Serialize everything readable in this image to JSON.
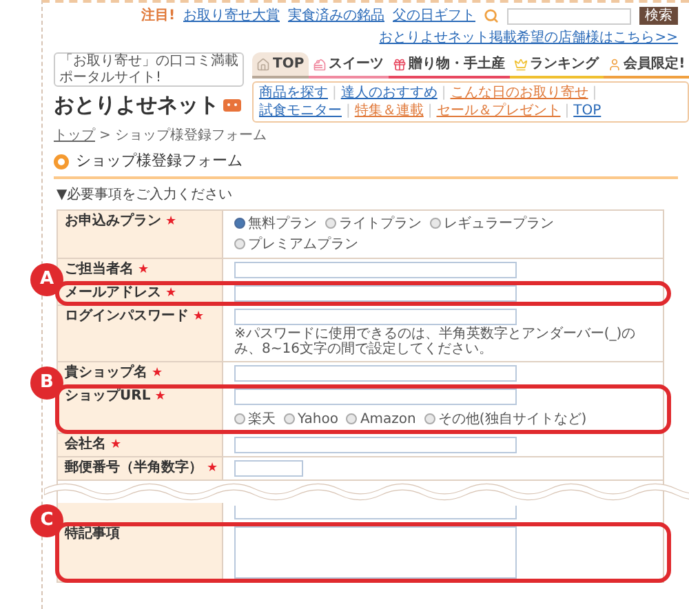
{
  "header": {
    "top_links": {
      "label": "注目!",
      "links": [
        "お取り寄せ大賞",
        "実食済みの銘品",
        "父の日ギフト"
      ]
    },
    "search": {
      "button": "検索"
    },
    "shop_link": "おとりよせネット掲載希望の店舗様はこちら>>",
    "tagline": "「お取り寄せ」の口コミ満載ポータルサイト!",
    "logo": "おとりよせネット",
    "main_nav": [
      {
        "label": "TOP",
        "color": "#b8a898",
        "selected": true
      },
      {
        "label": "スイーツ",
        "color": "#f08aa0",
        "selected": false
      },
      {
        "label": "贈り物・手土産",
        "color": "#e84860",
        "selected": false
      },
      {
        "label": "ランキング",
        "color": "#f0c030",
        "selected": false
      },
      {
        "label": "会員限定!",
        "color": "#f0a040",
        "selected": false
      }
    ],
    "sub_nav": [
      {
        "label": "商品を探す",
        "color": "#2a6ab8"
      },
      {
        "label": "達人のおすすめ",
        "color": "#2a6ab8"
      },
      {
        "label": "こんな日のお取り寄せ",
        "color": "#e07838"
      },
      {
        "label": "試食モニター",
        "color": "#2a6ab8"
      },
      {
        "label": "特集＆連載",
        "color": "#e07838"
      },
      {
        "label": "セール＆プレゼント",
        "color": "#e07838"
      },
      {
        "label": "TOP",
        "color": "#2a6ab8"
      }
    ],
    "separator": "|"
  },
  "breadcrumb": {
    "items": [
      "トップ",
      "ショップ様登録フォーム"
    ],
    "separator": ">"
  },
  "page_title": "ショップ様登録フォーム",
  "instructions": "▼必要事項をご入力ください",
  "required_mark": "★",
  "rows": [
    {
      "kind": "radio",
      "label": "お申込みプラン",
      "required": true,
      "options": [
        {
          "label": "無料プラン",
          "selected": true
        },
        {
          "label": "ライトプラン",
          "selected": false
        },
        {
          "label": "レギュラープラン",
          "selected": false
        },
        {
          "label": "プレミアムプラン",
          "selected": false
        }
      ]
    },
    {
      "kind": "text",
      "label": "ご担当者名",
      "required": true
    },
    {
      "kind": "text",
      "label": "メールアドレス",
      "required": true,
      "annotation": "A"
    },
    {
      "kind": "text",
      "label": "ログインパスワード",
      "required": true,
      "note": "※パスワードに使用できるのは、半角英数字とアンダーバー(_)のみ、8~16文字の間で設定してください。"
    },
    {
      "kind": "text",
      "label": "貴ショップ名",
      "required": true
    },
    {
      "kind": "url",
      "label": "ショップURL",
      "required": true,
      "annotation": "B",
      "options": [
        {
          "label": "楽天",
          "selected": false
        },
        {
          "label": "Yahoo",
          "selected": false
        },
        {
          "label": "Amazon",
          "selected": false
        },
        {
          "label": "その他(独自サイトなど)",
          "selected": false
        }
      ]
    },
    {
      "kind": "text",
      "label": "会社名",
      "required": true
    },
    {
      "kind": "short",
      "label": "郵便番号（半角数字）",
      "required": true
    },
    {
      "kind": "break"
    },
    {
      "kind": "textarea_end"
    },
    {
      "kind": "textarea",
      "label": "特記事項",
      "required": false,
      "annotation": "C"
    }
  ]
}
